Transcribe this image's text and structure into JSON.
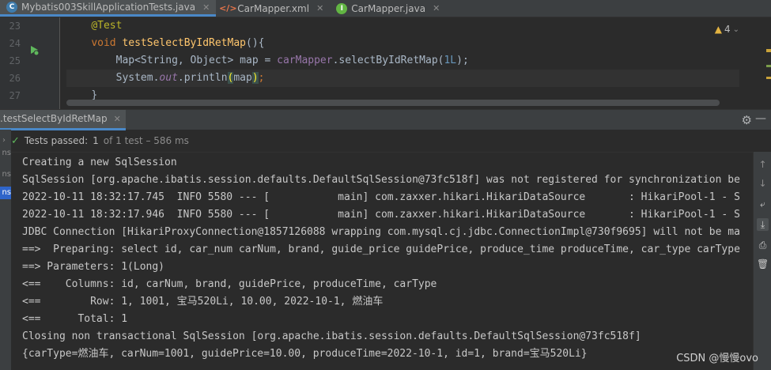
{
  "tabs": [
    {
      "label": "Mybatis003SkillApplicationTests.java",
      "icon": "java-class-icon",
      "active": true
    },
    {
      "label": "CarMapper.xml",
      "icon": "xml-file-icon",
      "active": false
    },
    {
      "label": "CarMapper.java",
      "icon": "interface-icon",
      "active": false
    }
  ],
  "editor": {
    "line_numbers": [
      "23",
      "24",
      "25",
      "26",
      "27"
    ],
    "annotation": "@Test",
    "kw_void": "void",
    "method_name": "testSelectByIdRetMap",
    "method_suffix": "(){",
    "line25_type": "Map<String, Object> ",
    "line25_var": "map",
    "line25_eq": " = ",
    "line25_obj": "carMapper",
    "line25_call": ".selectByIdRetMap(",
    "line25_arg": "1L",
    "line25_end": ");",
    "line26_sys": "System.",
    "line26_out": "out",
    "line26_println": ".println",
    "line26_open": "(",
    "line26_arg": "map",
    "line26_close": ")",
    "line26_end": ";",
    "line27": "}",
    "warning_count": "4"
  },
  "run": {
    "tab_label": ".testSelectByIdRetMap",
    "status_passed": "Tests passed:",
    "status_count": "1",
    "status_rest": "of 1 test – 586 ms",
    "side_labels": [
      "ns",
      "ns",
      "ns"
    ]
  },
  "console": [
    "Creating a new SqlSession",
    "SqlSession [org.apache.ibatis.session.defaults.DefaultSqlSession@73fc518f] was not registered for synchronization be",
    "2022-10-11 18:32:17.745  INFO 5580 --- [           main] com.zaxxer.hikari.HikariDataSource       : HikariPool-1 - S",
    "2022-10-11 18:32:17.946  INFO 5580 --- [           main] com.zaxxer.hikari.HikariDataSource       : HikariPool-1 - S",
    "JDBC Connection [HikariProxyConnection@1857126088 wrapping com.mysql.cj.jdbc.ConnectionImpl@730f9695] will not be ma",
    "==>  Preparing: select id, car_num carNum, brand, guide_price guidePrice, produce_time produceTime, car_type carType",
    "==> Parameters: 1(Long)",
    "<==    Columns: id, carNum, brand, guidePrice, produceTime, carType",
    "<==        Row: 1, 1001, 宝马520Li, 10.00, 2022-10-1, 燃油车",
    "<==      Total: 1",
    "Closing non transactional SqlSession [org.apache.ibatis.session.defaults.DefaultSqlSession@73fc518f]",
    "{carType=燃油车, carNum=1001, guidePrice=10.00, produceTime=2022-10-1, id=1, brand=宝马520Li}"
  ],
  "watermark": "CSDN @慢慢ovo",
  "colors": {
    "accent": "#4a88c7",
    "passed": "#5fb85c",
    "keyword": "#cc7832",
    "method": "#ffc66d"
  }
}
